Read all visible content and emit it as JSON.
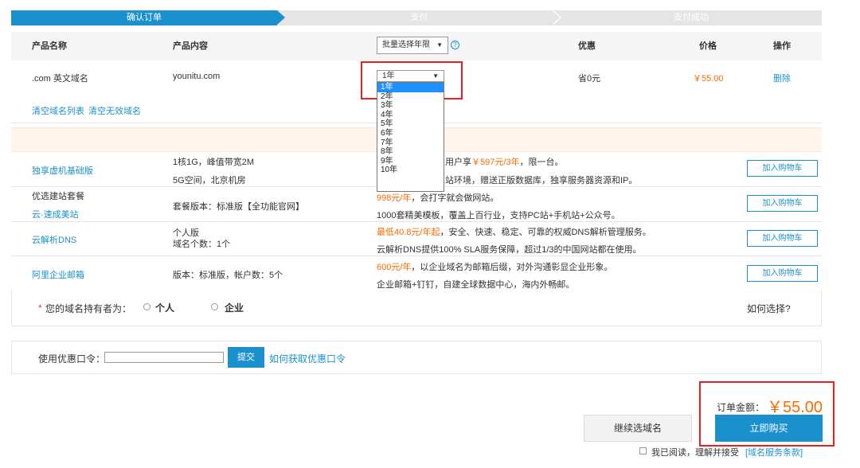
{
  "steps": [
    "确认订单",
    "支付",
    "支付成功"
  ],
  "table_header": {
    "name": "产品名称",
    "content": "产品内容",
    "period_select": "批量选择年限",
    "discount": "优惠",
    "price": "价格",
    "action": "操作"
  },
  "order_row": {
    "name": ".com 英文域名",
    "content": "younitu.com",
    "period": "1年",
    "discount": "省0元",
    "price": "￥55.00",
    "delete": "删除"
  },
  "period_options": [
    "1年",
    "2年",
    "3年",
    "4年",
    "5年",
    "6年",
    "7年",
    "8年",
    "9年",
    "10年"
  ],
  "clear_links": {
    "clear_list": "清空域名列表",
    "clear_invalid": "清空无效域名"
  },
  "recommend": [
    {
      "name": "独享虚机基础版",
      "content1": "1核1G，峰值带宽2M",
      "content2": "5G空间，北京机房",
      "desc1_plain": "用户享",
      "desc1_price": "￥597元/3年",
      "desc1_tail": "，限一台。",
      "desc2": "站环境，赠送正版数据库，独享服务器资源和IP。",
      "button": "加入购物车"
    },
    {
      "name": "优选建站套餐",
      "name_sub": "云·速成美站",
      "content1": "套餐版本：标准版【全功能官网】",
      "desc1_price": "998元/年",
      "desc1_tail": "，会打字就会做网站。",
      "desc2": "1000套精美模板，覆盖上百行业，支持PC站+手机站+公众号。",
      "button": "加入购物车"
    },
    {
      "name": "云解析DNS",
      "content1": "个人版",
      "content2": "域名个数：1个",
      "desc1_price": "最低40.8元/年起",
      "desc1_tail": "，安全、快速、稳定、可靠的权威DNS解析管理服务。",
      "desc2": "云解析DNS提供100% SLA服务保障，超过1/3的中国网站都在使用。",
      "button": "加入购物车"
    },
    {
      "name": "阿里企业邮箱",
      "content1": "版本：标准版，帐户数：5个",
      "desc1_price": "600元/年",
      "desc1_tail": "，以企业域名为邮箱后缀，对外沟通彰显企业形象。",
      "desc2": "企业邮箱+钉钉，自建全球数据中心，海内外畅邮。",
      "button": "加入购物车"
    }
  ],
  "owner": {
    "required": "*",
    "label": "您的域名持有者为：",
    "personal": "个人",
    "company": "企业",
    "how": "如何选择?"
  },
  "coupon": {
    "label": "使用优惠口令：",
    "submit": "提交",
    "how": "如何获取优惠口令"
  },
  "order": {
    "total_label": "订单金额：",
    "total": "￥55.00",
    "continue": "继续选域名",
    "buy": "立即购买",
    "agree_text": "我已阅读，理解并接受",
    "agree_link": "[域名服务条款]"
  },
  "colors": {
    "accent": "#1a91cc",
    "price": "#ff6a00",
    "highlight": "#e82020"
  }
}
